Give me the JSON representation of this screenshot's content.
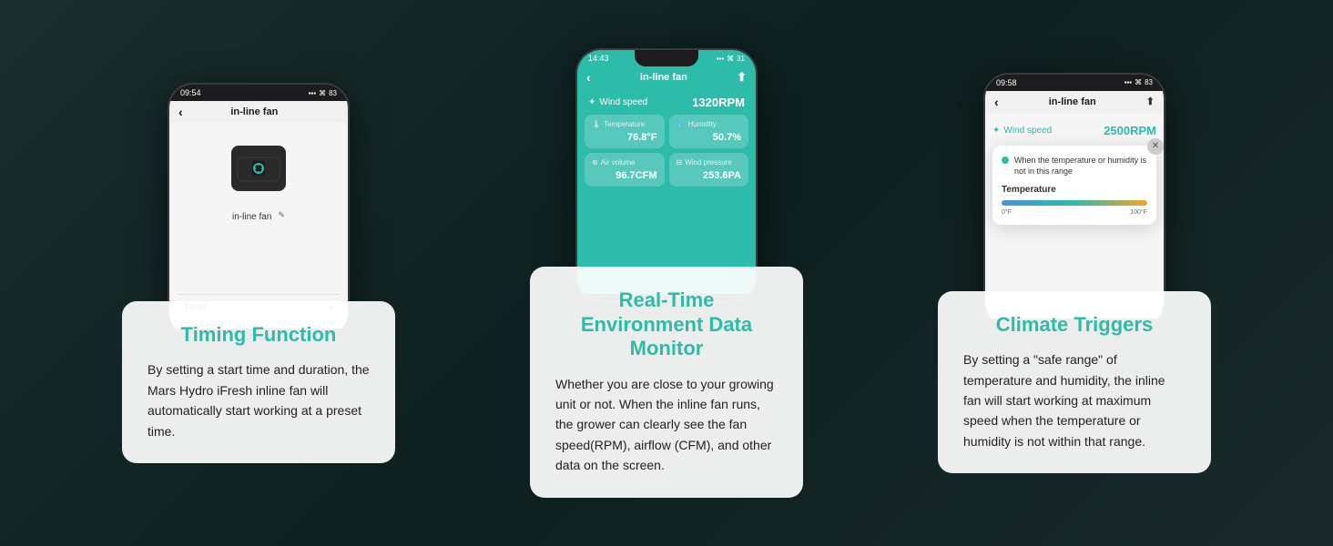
{
  "background": "#1a2a2a",
  "sections": [
    {
      "id": "timing",
      "phone": {
        "time": "09:54",
        "signal": "▪▪▪",
        "wifi": "wifi",
        "battery": "83",
        "title": "in-line fan",
        "theme": "light",
        "device_label": "in-line fan",
        "menu_item": "Timer",
        "wind_speed_label": "",
        "wind_speed_value": ""
      },
      "card": {
        "title": "Timing Function",
        "body": "By setting a start time and duration, the Mars Hydro iFresh inline fan will automatically start working at a preset time."
      }
    },
    {
      "id": "realtime",
      "phone": {
        "time": "14:43",
        "signal": "▪▪▪",
        "wifi": "wifi",
        "battery": "31",
        "title": "in-line fan",
        "theme": "teal",
        "wind_speed_label": "Wind speed",
        "wind_speed_value": "1320RPM",
        "temp_label": "Temperature",
        "temp_value": "76.8°F",
        "humidity_label": "Humidity",
        "humidity_value": "50.7%",
        "air_label": "Air volume",
        "air_value": "96.7CFM",
        "wind_pressure_label": "Wind pressure",
        "wind_pressure_value": "253.6PA"
      },
      "card": {
        "title": "Real-Time\nEnvironment Data Monitor",
        "body": "Whether you are close to your growing unit or not. When the inline fan runs, the grower can clearly see the fan speed(RPM), airflow (CFM), and other data on the screen."
      }
    },
    {
      "id": "climate",
      "phone": {
        "time": "09:58",
        "signal": "▪▪▪",
        "wifi": "wifi",
        "battery": "83",
        "title": "in-line fan",
        "theme": "light",
        "wind_speed_label": "Wind speed",
        "wind_speed_value": "2500RPM",
        "popup_text": "When the temperature or humidity is not in this range",
        "popup_section": "Temperature",
        "temp_min": "0°F",
        "temp_max": "100°F"
      },
      "card": {
        "title": "Climate Triggers",
        "body": "By setting a \"safe range\" of temperature and humidity, the inline fan will start working at maximum speed when the temperature or humidity is not within that range."
      }
    }
  ],
  "icons": {
    "back": "‹",
    "share": "⬆",
    "fan": "⊕",
    "wind": "❃",
    "thermometer": "🌡",
    "droplet": "💧",
    "air": "⊚",
    "pressure": "⊟",
    "edit": "✎",
    "close": "✕",
    "chevron_right": "›",
    "dot_green": "●"
  }
}
